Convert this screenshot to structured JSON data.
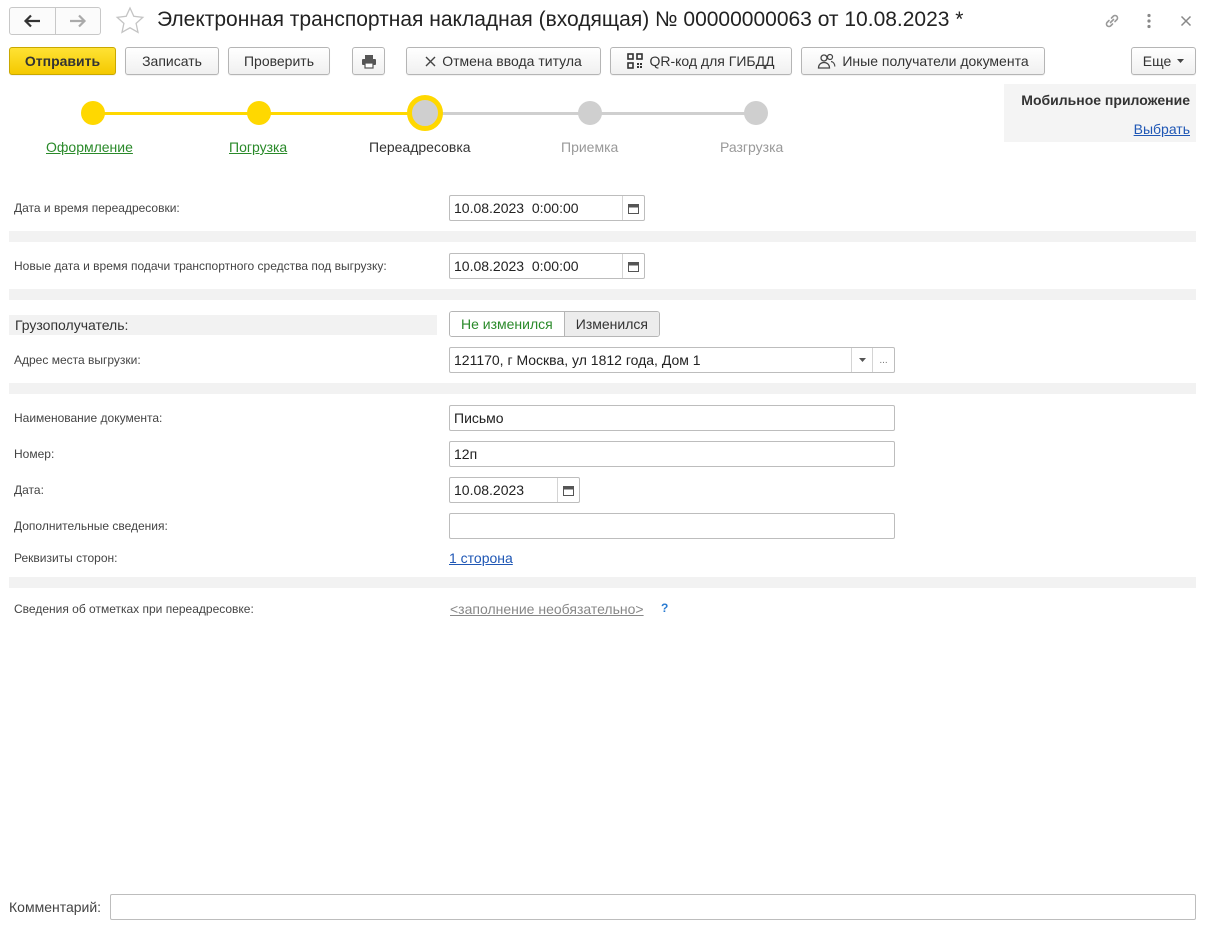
{
  "window": {
    "title": "Электронная транспортная накладная (входящая) № 00000000063 от 10.08.2023 *"
  },
  "toolbar": {
    "send_label": "Отправить",
    "save_label": "Записать",
    "check_label": "Проверить",
    "cancel_title_label": "Отмена ввода титула",
    "qr_label": "QR-код для ГИБДД",
    "other_recipients_label": "Иные получатели документа",
    "more_label": "Еще"
  },
  "stepper": {
    "steps": [
      {
        "label": "Оформление",
        "state": "done"
      },
      {
        "label": "Погрузка",
        "state": "done"
      },
      {
        "label": "Переадресовка",
        "state": "current"
      },
      {
        "label": "Приемка",
        "state": "todo"
      },
      {
        "label": "Разгрузка",
        "state": "todo"
      }
    ]
  },
  "mobile_app": {
    "title": "Мобильное приложение",
    "select_link": "Выбрать"
  },
  "form": {
    "redirect_datetime": {
      "label": "Дата и время переадресовки:",
      "value": "10.08.2023  0:00:00"
    },
    "new_delivery_datetime": {
      "label": "Новые дата и время подачи транспортного средства под выгрузку:",
      "value": "10.08.2023  0:00:00"
    },
    "consignee": {
      "label": "Грузополучатель:",
      "option_unchanged": "Не изменился",
      "option_changed": "Изменился",
      "selected": "Не изменился"
    },
    "unload_address": {
      "label": "Адрес места выгрузки:",
      "value": "121170, г Москва, ул 1812 года, Дом 1"
    },
    "document_name": {
      "label": "Наименование документа:",
      "value": "Письмо"
    },
    "number": {
      "label": "Номер:",
      "value": "12п"
    },
    "date": {
      "label": "Дата:",
      "value": "10.08.2023"
    },
    "additional_info": {
      "label": "Дополнительные сведения:",
      "value": ""
    },
    "party_details": {
      "label": "Реквизиты сторон:",
      "link": "1 сторона"
    },
    "redirect_marks": {
      "label": "Сведения об отметках при переадресовке:",
      "link": "<заполнение необязательно>",
      "help": "?"
    }
  },
  "footer": {
    "comment_label": "Комментарий:",
    "comment_value": ""
  },
  "colors": {
    "accent_yellow": "#ffd800",
    "done_green": "#2a8a2a",
    "link_blue": "#1f57b5",
    "inactive_gray": "#cfcfcf"
  },
  "icons": [
    "arrow-left-icon",
    "arrow-right-icon",
    "star-icon",
    "link-icon",
    "kebab-menu-icon",
    "close-icon",
    "printer-icon",
    "cross-icon",
    "qr-code-icon",
    "users-icon",
    "dropdown-arrow-icon",
    "calendar-icon",
    "help-icon"
  ]
}
